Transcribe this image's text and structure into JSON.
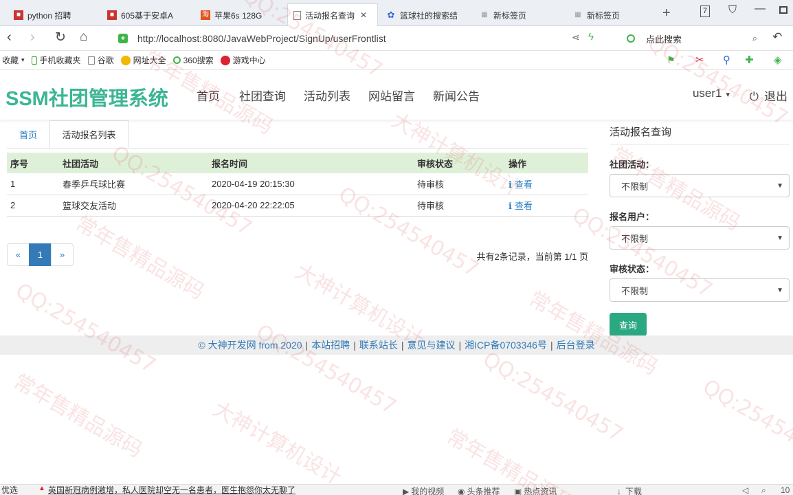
{
  "browser": {
    "tabs": [
      {
        "title": "python 招聘",
        "icon": "red-favicon-icon"
      },
      {
        "title": "605基于安卓A",
        "icon": "red-favicon-icon"
      },
      {
        "title": "苹果6s 128G",
        "icon": "taobao-favicon-icon"
      },
      {
        "title": "活动报名查询",
        "icon": "page-icon",
        "active": true
      },
      {
        "title": "篮球社的搜索结",
        "icon": "baidu-paw-icon"
      },
      {
        "title": "新标签页",
        "icon": "grid-icon"
      },
      {
        "title": "新标签页",
        "icon": "grid-icon"
      }
    ],
    "url_host": "http://localhost",
    "url_rest": ":8080/JavaWebProject/SignUp/userFrontlist",
    "search_placeholder": "点此搜索",
    "bookmarks": [
      "收藏",
      "手机收藏夹",
      "谷歌",
      "网址大全",
      "360搜索",
      "游戏中心"
    ],
    "tab_counter": "7"
  },
  "site": {
    "brand": "SSM社团管理系统",
    "nav": [
      "首页",
      "社团查询",
      "活动列表",
      "网站留言",
      "新闻公告"
    ],
    "user": "user1",
    "logout": "退出"
  },
  "breadcrumb": {
    "home": "首页",
    "current": "活动报名列表"
  },
  "table": {
    "headers": [
      "序号",
      "社团活动",
      "报名时间",
      "审核状态",
      "操作"
    ],
    "rows": [
      {
        "no": "1",
        "activity": "春季乒乓球比赛",
        "time": "2020-04-19 20:15:30",
        "status": "待审核",
        "action": "查看"
      },
      {
        "no": "2",
        "activity": "篮球交友活动",
        "time": "2020-04-20 22:22:05",
        "status": "待审核",
        "action": "查看"
      }
    ]
  },
  "pager": {
    "prev": "«",
    "current": "1",
    "next": "»",
    "info": "共有2条记录，当前第 1/1 页"
  },
  "sidebar": {
    "title": "活动报名查询",
    "fields": [
      {
        "label": "社团活动：",
        "value": "不限制"
      },
      {
        "label": "报名用户：",
        "value": "不限制"
      },
      {
        "label": "审核状态：",
        "value": "不限制"
      }
    ],
    "button": "查询"
  },
  "footer": {
    "links": [
      "© 大神开发网 from 2020",
      "本站招聘",
      "联系站长",
      "意见与建议",
      "湘ICP备0703346号",
      "后台登录"
    ]
  },
  "statusbar": {
    "left": "优选",
    "news": "英国新冠病例激增，私人医院却空无一名患者，医生抱怨你太无聊了",
    "items": [
      "我的视频",
      "头条推荐",
      "热点资讯",
      "下载"
    ],
    "zoom": "10"
  },
  "watermark_texts": [
    "QQ:254540457",
    "常年售精品源码",
    "大神计算机设计"
  ]
}
